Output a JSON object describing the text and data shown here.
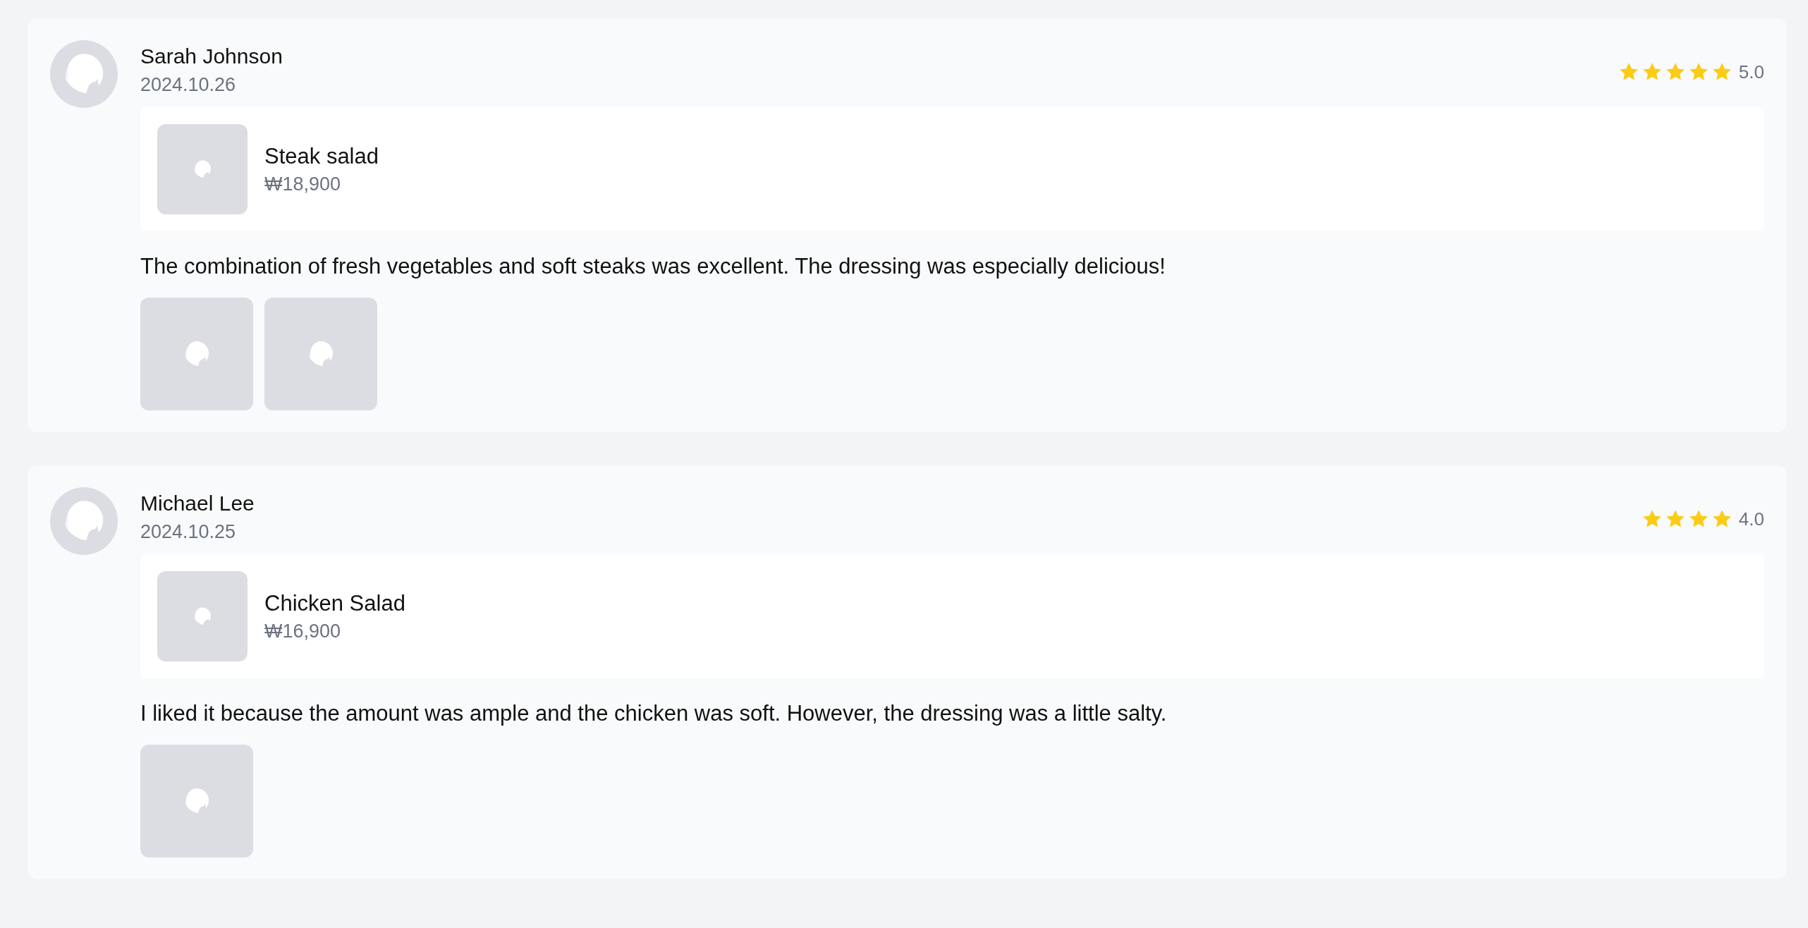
{
  "reviews": [
    {
      "author": "Sarah Johnson",
      "date": "2024.10.26",
      "stars": 5,
      "rating": "5.0",
      "product": {
        "name": "Steak salad",
        "price": "₩18,900"
      },
      "text": "The combination of fresh vegetables and soft steaks was excellent. The dressing was especially delicious!",
      "photos": [
        {
          "kind": "picture"
        },
        {
          "kind": "picture"
        }
      ]
    },
    {
      "author": "Michael Lee",
      "date": "2024.10.25",
      "stars": 4,
      "rating": "4.0",
      "product": {
        "name": "Chicken Salad",
        "price": "₩16,900"
      },
      "text": "I liked it because the amount was ample and the chicken was soft. However, the dressing was a little salty.",
      "photos": [
        {
          "kind": "picture"
        }
      ]
    }
  ]
}
